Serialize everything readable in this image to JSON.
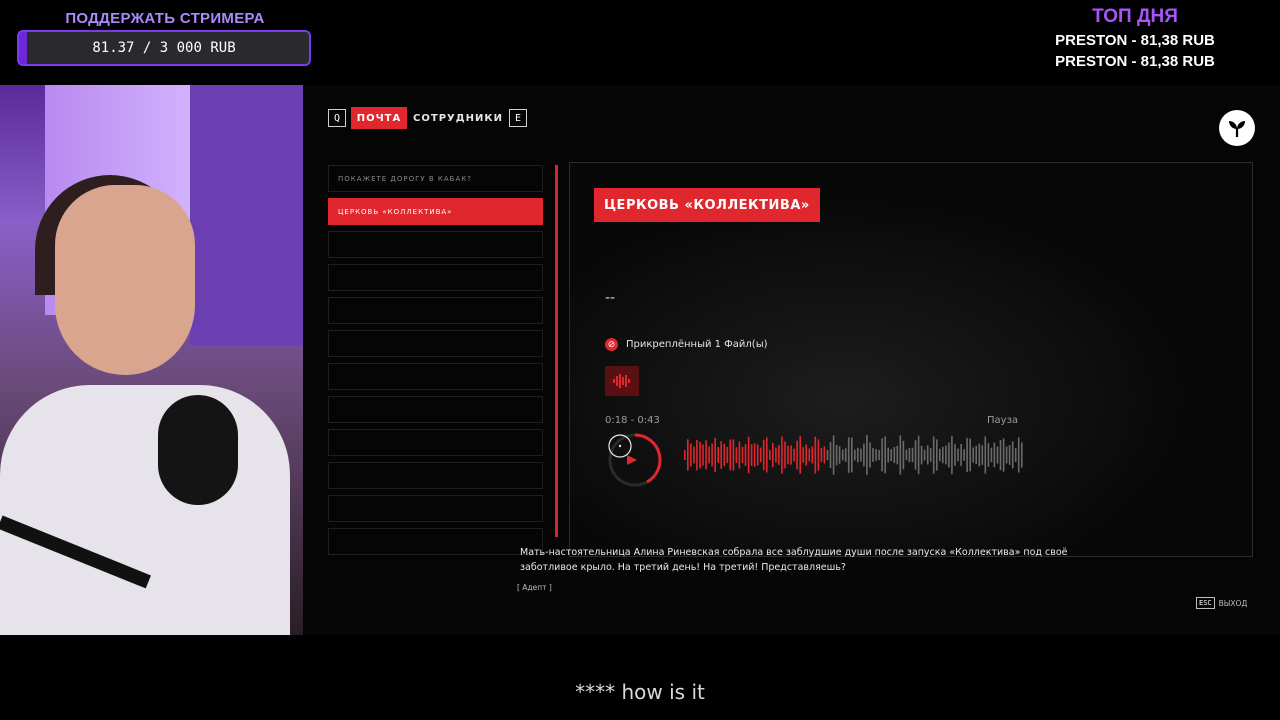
{
  "donation": {
    "title": "ПОДДЕРЖАТЬ СТРИМЕРА",
    "progress_text": "81.37 / 3 000 RUB",
    "progress_fraction": 0.027,
    "accent": "#7c3aed"
  },
  "top_day": {
    "title": "ТОП ДНЯ",
    "entries": [
      "PRESTON - 81,38 RUB",
      "PRESTON - 81,38 RUB"
    ]
  },
  "game": {
    "tabs": {
      "key_left": "Q",
      "mail": "ПОЧТА",
      "staff": "СОТРУДНИКИ",
      "key_right": "E"
    },
    "logo_icon": "sprout-logo-icon",
    "mail_list": [
      "ПОКАЖЕТЕ ДОРОГУ В КАБАК?",
      "ЦЕРКОВЬ «КОЛЛЕКТИВА»",
      "",
      "",
      "",
      "",
      "",
      "",
      "",
      "",
      "",
      ""
    ],
    "selected_index": 1,
    "detail": {
      "title": "ЦЕРКОВЬ «КОЛЛЕКТИВА»",
      "body": "--",
      "attachment": "Прикреплённый 1 Файл(ы)",
      "time": "0:18 - 0:43",
      "state": "Пауза",
      "progress_fraction": 0.42
    },
    "subtitle": "Мать-настоятельница Алина Риневская собрала все заблудшие души после запуска «Коллектива» под своё заботливое крыло. На третий день! На третий! Представляешь?",
    "speaker": "[ Адепт ]",
    "esc_key": "ESC",
    "esc_label": "ВЫХОД",
    "accent": "#e0272e"
  },
  "caption": "**** how is it"
}
